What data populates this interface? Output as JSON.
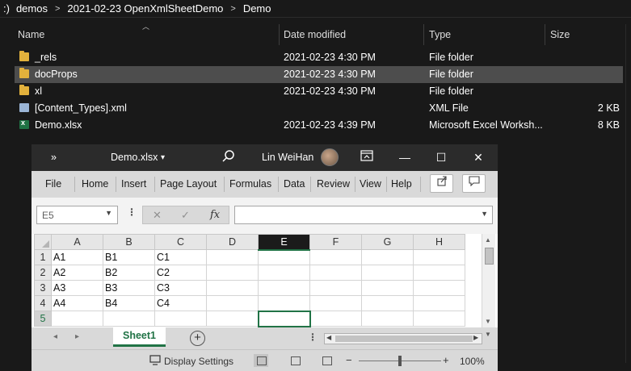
{
  "breadcrumb": {
    "items": [
      ":)",
      "demos",
      "2021-02-23 OpenXmlSheetDemo",
      "Demo"
    ],
    "separator": ">"
  },
  "columns": {
    "name": "Name",
    "date": "Date modified",
    "type": "Type",
    "size": "Size"
  },
  "files": [
    {
      "name": "_rels",
      "date": "2021-02-23 4:30 PM",
      "type": "File folder",
      "size": "",
      "icon": "folder-icon"
    },
    {
      "name": "docProps",
      "date": "2021-02-23 4:30 PM",
      "type": "File folder",
      "size": "",
      "icon": "folder-icon"
    },
    {
      "name": "xl",
      "date": "2021-02-23 4:30 PM",
      "type": "File folder",
      "size": "",
      "icon": "folder-icon"
    },
    {
      "name": "[Content_Types].xml",
      "date": "",
      "type": "XML File",
      "size": "2 KB",
      "icon": "xml-file-icon"
    },
    {
      "name": "Demo.xlsx",
      "date": "2021-02-23 4:39 PM",
      "type": "Microsoft Excel Worksh...",
      "size": "8 KB",
      "icon": "excel-file-icon"
    }
  ],
  "excel": {
    "title_caret": "»",
    "doc_title": "Demo.xlsx",
    "title_dropdown": "▾",
    "user": "Lin WeiHan",
    "window_buttons": {
      "minimize": "—",
      "maximize": "☐",
      "close": "✕"
    },
    "menu": [
      "File",
      "Home",
      "Insert",
      "Page Layout",
      "Formulas",
      "Data",
      "Review",
      "View",
      "Help"
    ],
    "name_box": "E5",
    "fx": "fx",
    "cancel_glyph": "✕",
    "enter_glyph": "✓",
    "dots": "⋮",
    "grid": {
      "columns": [
        "A",
        "B",
        "C",
        "D",
        "E",
        "F",
        "G",
        "H"
      ],
      "rows": [
        {
          "num": "1",
          "cells": [
            "A1",
            "B1",
            "C1",
            "",
            "",
            "",
            "",
            ""
          ]
        },
        {
          "num": "2",
          "cells": [
            "A2",
            "B2",
            "C2",
            "",
            "",
            "",
            "",
            ""
          ]
        },
        {
          "num": "3",
          "cells": [
            "A3",
            "B3",
            "C3",
            "",
            "",
            "",
            "",
            ""
          ]
        },
        {
          "num": "4",
          "cells": [
            "A4",
            "B4",
            "C4",
            "",
            "",
            "",
            "",
            ""
          ]
        },
        {
          "num": "5",
          "cells": [
            "",
            "",
            "",
            "",
            "",
            "",
            "",
            ""
          ]
        }
      ],
      "active_column": "E",
      "active_row": "5"
    },
    "sheet_tab": "Sheet1",
    "add_sheet": "+",
    "status": {
      "display_settings": "Display Settings",
      "zoom_minus": "−",
      "zoom_plus": "+",
      "zoom": "100%",
      "zoom_level_fraction": 0.5
    }
  }
}
